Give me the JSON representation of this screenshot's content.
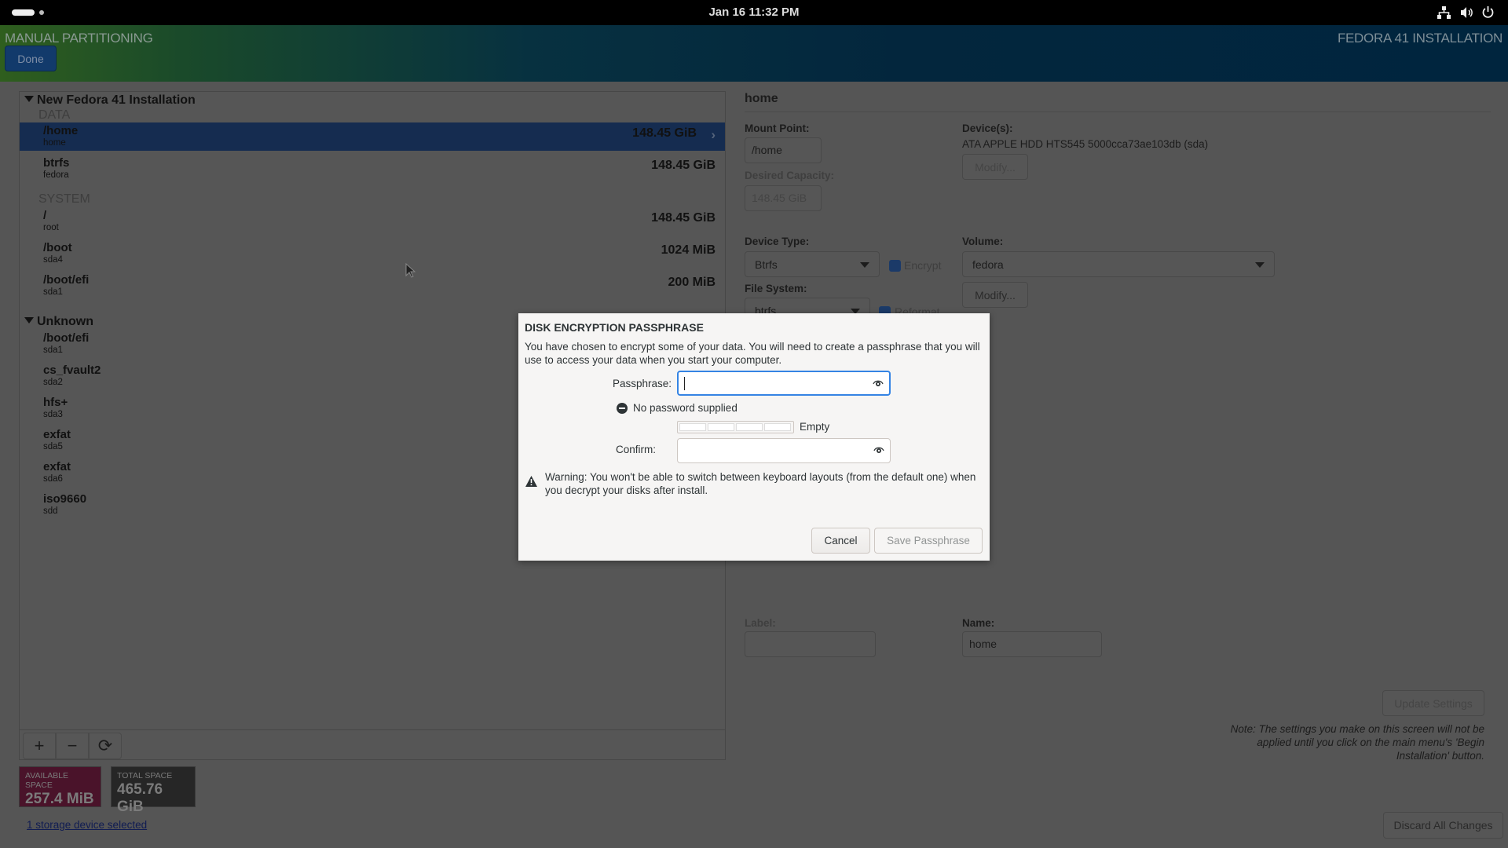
{
  "topbar": {
    "clock": "Jan 16  11:32 PM",
    "icons": [
      "network-icon",
      "volume-icon",
      "power-icon"
    ]
  },
  "header": {
    "title": "MANUAL PARTITIONING",
    "done_label": "Done",
    "product": "FEDORA 41 INSTALLATION"
  },
  "tree": {
    "group1": "New Fedora 41 Installation",
    "section_data": "DATA",
    "data_items": [
      {
        "name": "/home",
        "sub": "home",
        "size": "148.45 GiB",
        "selected": true
      },
      {
        "name": "btrfs",
        "sub": "fedora",
        "size": "148.45 GiB"
      }
    ],
    "section_system": "SYSTEM",
    "system_items": [
      {
        "name": "/",
        "sub": "root",
        "size": "148.45 GiB"
      },
      {
        "name": "/boot",
        "sub": "sda4",
        "size": "1024 MiB"
      },
      {
        "name": "/boot/efi",
        "sub": "sda1",
        "size": "200 MiB"
      }
    ],
    "group2": "Unknown",
    "unknown_items": [
      {
        "name": "/boot/efi",
        "sub": "sda1"
      },
      {
        "name": "cs_fvault2",
        "sub": "sda2"
      },
      {
        "name": "hfs+",
        "sub": "sda3"
      },
      {
        "name": "exfat",
        "sub": "sda5"
      },
      {
        "name": "exfat",
        "sub": "sda6"
      },
      {
        "name": "iso9660",
        "sub": "sdd"
      }
    ]
  },
  "toolbar": {
    "add": "+",
    "remove": "−",
    "refresh": "⟳"
  },
  "space": {
    "available_label": "AVAILABLE SPACE",
    "available_value": "257.4 MiB",
    "total_label": "TOTAL SPACE",
    "total_value": "465.76 GiB",
    "available_color": "#4a132a"
  },
  "storage_link": "1 storage device selected",
  "details": {
    "heading": "home",
    "mount_point_label": "Mount Point:",
    "mount_point_value": "/home",
    "capacity_label": "Desired Capacity:",
    "capacity_value": "148.45 GiB",
    "devices_label": "Device(s):",
    "devices_value": "ATA APPLE HDD HTS545 5000cca73ae103db (sda)",
    "modify_label": "Modify...",
    "device_type_label": "Device Type:",
    "device_type_value": "Btrfs",
    "encrypt_label": "Encrypt",
    "encrypt_checked": true,
    "volume_label": "Volume:",
    "volume_value": "fedora",
    "filesystem_label": "File System:",
    "filesystem_value": "btrfs",
    "reformat_label": "Reformat",
    "reformat_checked": true,
    "label_label": "Label:",
    "label_value": "",
    "name_label": "Name:",
    "name_value": "home",
    "update_label": "Update Settings",
    "note": "Note:  The settings you make on this screen will not be applied until you click on the main menu's 'Begin Installation' button.",
    "discard_label": "Discard All Changes"
  },
  "dialog": {
    "title": "DISK ENCRYPTION PASSPHRASE",
    "description": "You have chosen to encrypt some of your data. You will need to create a passphrase that you will use to access your data when you start your computer.",
    "passphrase_label": "Passphrase:",
    "passphrase_value": "",
    "status": "No password supplied",
    "strength_label": "Empty",
    "strength_level": 0,
    "confirm_label": "Confirm:",
    "confirm_value": "",
    "warning": "Warning: You won't be able to switch between keyboard layouts (from the default one) when you decrypt your disks after install.",
    "cancel_label": "Cancel",
    "save_label": "Save Passphrase"
  }
}
